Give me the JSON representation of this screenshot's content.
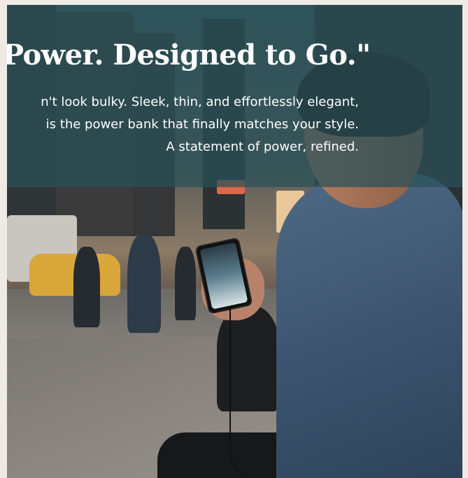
{
  "hero": {
    "headline": "r Power. Designed to Go.\"",
    "lines": [
      "n't look bulky. Sleek, thin, and effortlessly elegant,",
      "is the power bank that finally matches your style.",
      "A statement of power, refined."
    ]
  },
  "colors": {
    "overlay": "#285058",
    "text": "#ffffff",
    "page_background": "#efeae3"
  }
}
